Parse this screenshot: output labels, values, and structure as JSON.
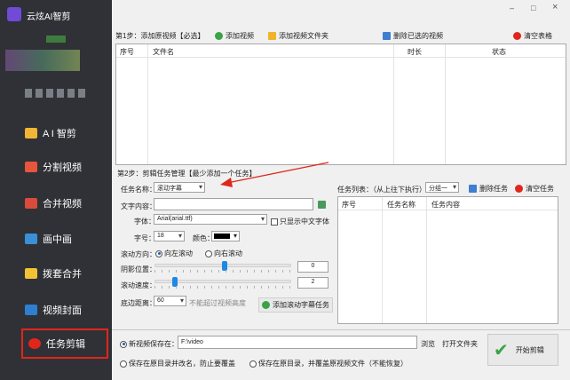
{
  "app": {
    "title": "云炫AI智剪"
  },
  "window": {
    "minimize": "–",
    "maximize": "□",
    "close": "×"
  },
  "sidebar": {
    "items": [
      {
        "label": "A I 智剪",
        "color": "#f2b635"
      },
      {
        "label": "分割视频",
        "color": "#e8553d"
      },
      {
        "label": "合并视频",
        "color": "#d94b3c"
      },
      {
        "label": "画中画",
        "color": "#3b8fd8"
      },
      {
        "label": "拨套合并",
        "color": "#f1c234"
      },
      {
        "label": "视频封面",
        "color": "#2f7fd1"
      },
      {
        "label": "任务剪辑",
        "color": "#e0261b"
      }
    ]
  },
  "step1": {
    "label": "第1步：添加原视频【必选】",
    "add_video": "添加视频",
    "add_folder": "添加视频文件夹",
    "delete_selected": "删除已选的视频",
    "clear_table": "清空表格",
    "columns": [
      "序号",
      "文件名",
      "时长",
      "状态"
    ]
  },
  "step2": {
    "label": "第2步：剪辑任务管理【最少添加一个任务】",
    "task_name_label": "任务名称：",
    "task_name_value": "滚动字幕",
    "text_content_label": "文字内容：",
    "text_content_value": "",
    "font_label": "字体：",
    "font_value": "Arial(arial.ttf)",
    "cjk_only_label": "只显示中文字体",
    "size_label": "字号：",
    "size_value": "18",
    "color_label": "颜色：",
    "direction_label": "滚动方向：",
    "direction_left": "向左滚动",
    "direction_right": "向右滚动",
    "shadow_label": "阴影位置：",
    "shadow_value": "0",
    "speed_label": "滚动速度：",
    "speed_value": "2",
    "bottom_label": "底边距离：",
    "bottom_value": "60",
    "bottom_hint": "不能超过视频高度",
    "add_task_btn": "添加滚动字幕任务",
    "task_list_label": "任务列表：（从上往下执行）",
    "group_value": "分组一",
    "delete_task": "删除任务",
    "clear_tasks": "清空任务",
    "task_columns": [
      "序号",
      "任务名称",
      "任务内容"
    ]
  },
  "output": {
    "save_label": "新视频保存在：",
    "path_value": "F:\\video",
    "browse": "浏览",
    "open_folder": "打开文件夹",
    "opt_rename": "保存在原目录并改名，防止要覆盖",
    "opt_overwrite": "保存在原目录，并覆盖原视频文件（不能恢复）",
    "start": "开始剪辑"
  }
}
